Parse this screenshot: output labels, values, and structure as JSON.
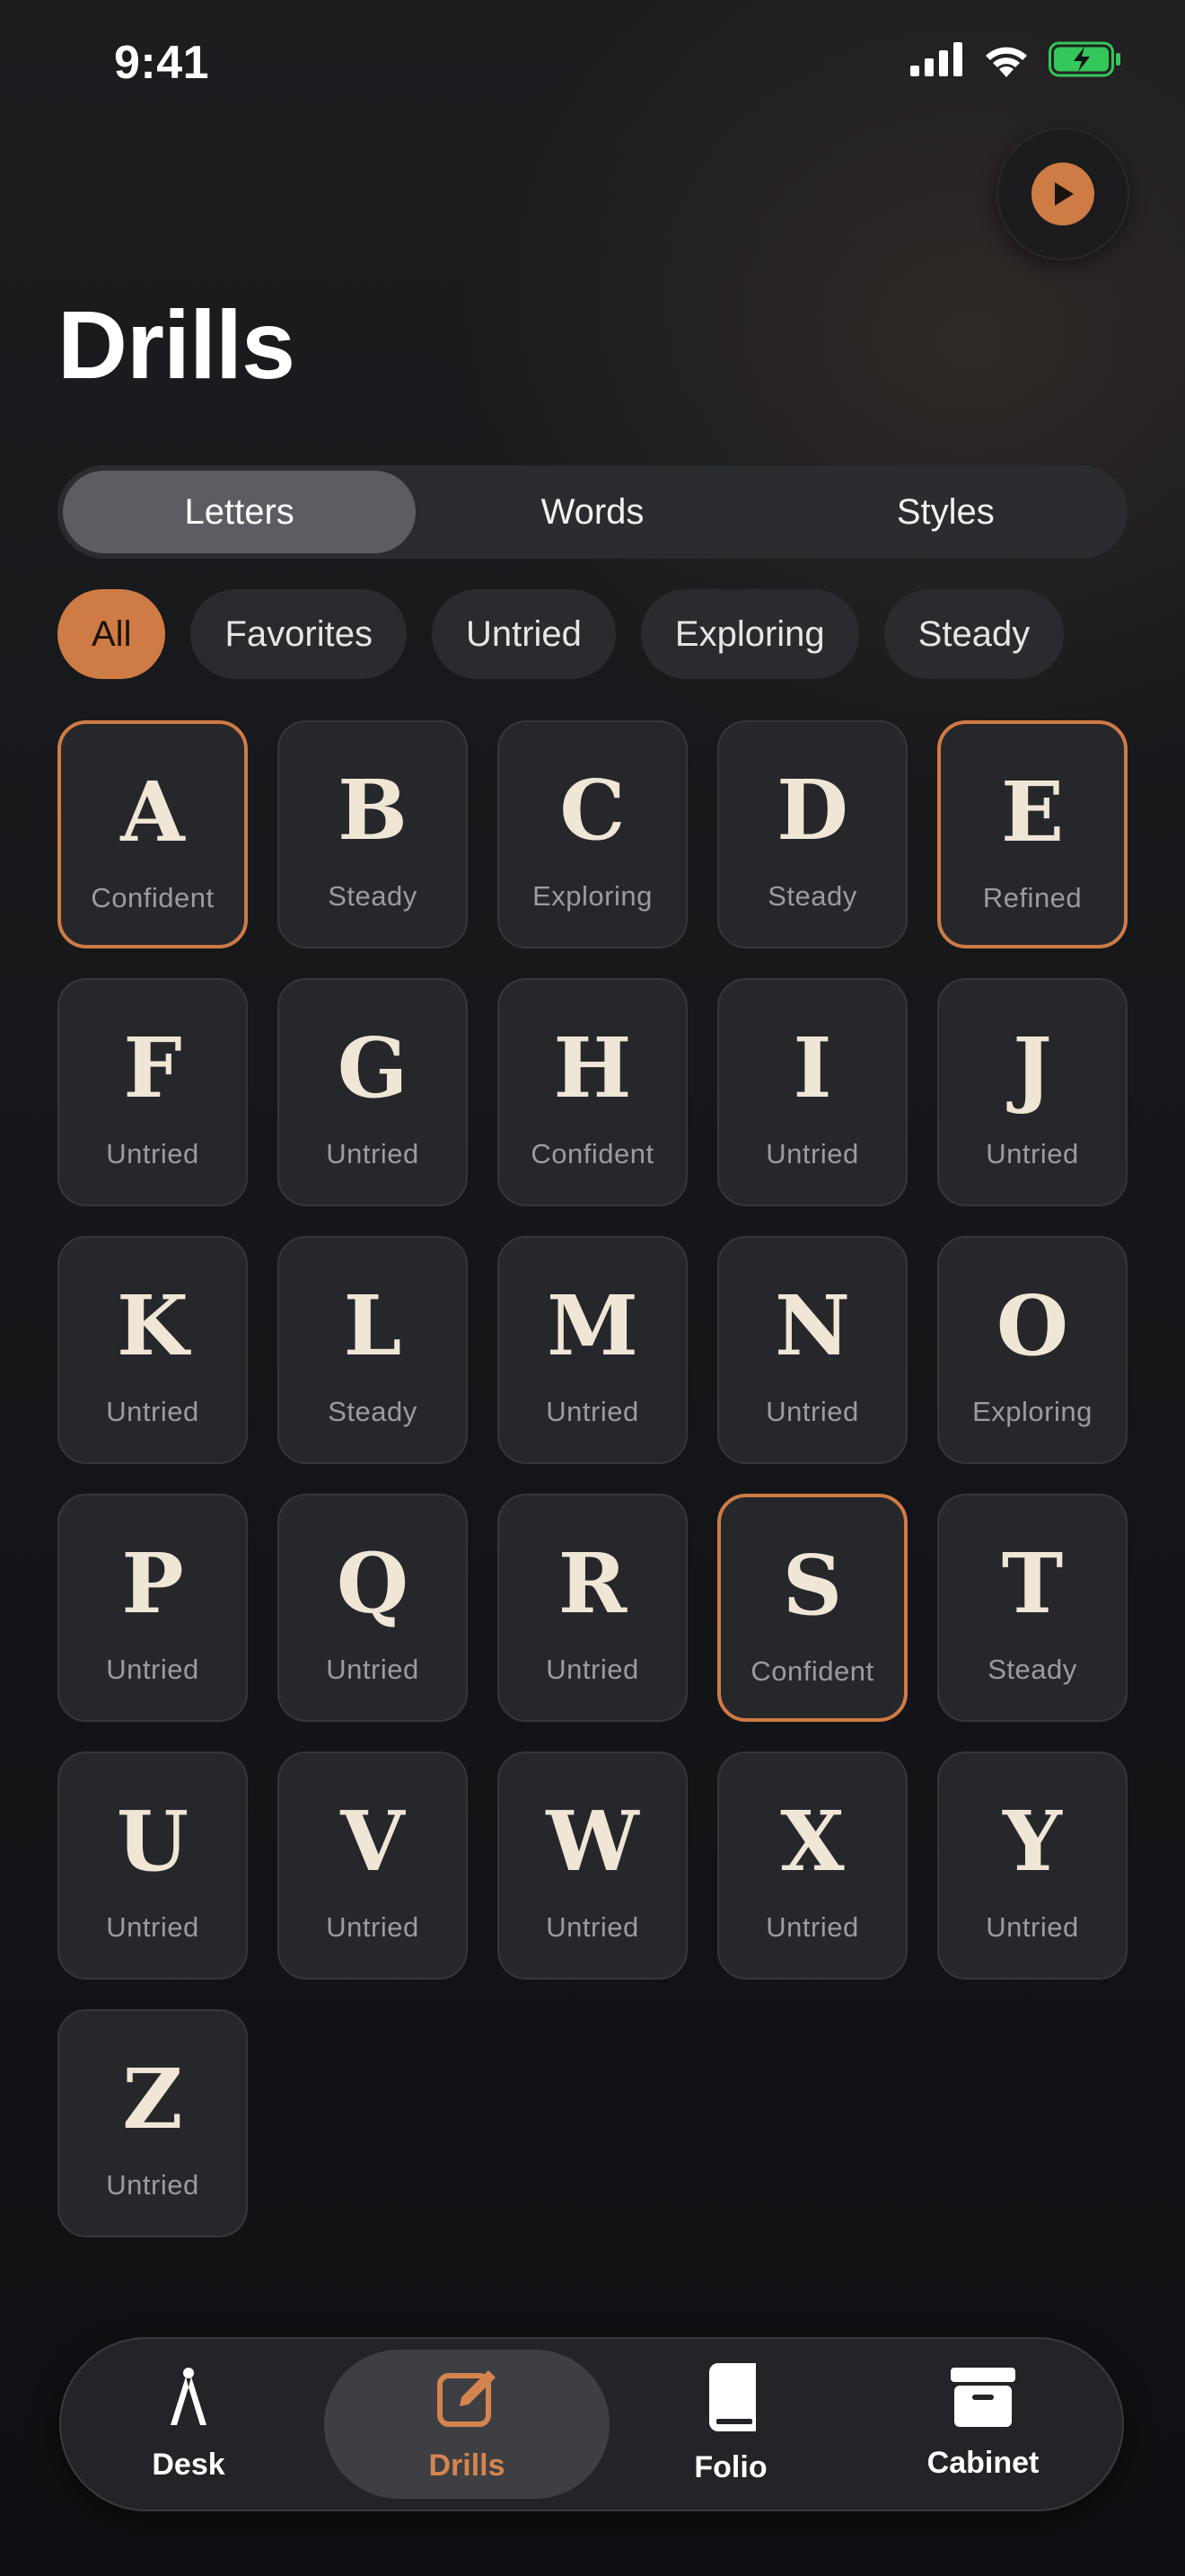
{
  "status_bar": {
    "time": "9:41"
  },
  "header": {
    "title": "Drills",
    "play_icon": "play-icon"
  },
  "segments": [
    {
      "label": "Letters",
      "active": true
    },
    {
      "label": "Words",
      "active": false
    },
    {
      "label": "Styles",
      "active": false
    }
  ],
  "filters": [
    {
      "label": "All",
      "active": true
    },
    {
      "label": "Favorites",
      "active": false
    },
    {
      "label": "Untried",
      "active": false
    },
    {
      "label": "Exploring",
      "active": false
    },
    {
      "label": "Steady",
      "active": false
    }
  ],
  "letters": [
    {
      "letter": "A",
      "status": "Confident",
      "highlight": true
    },
    {
      "letter": "B",
      "status": "Steady",
      "highlight": false
    },
    {
      "letter": "C",
      "status": "Exploring",
      "highlight": false
    },
    {
      "letter": "D",
      "status": "Steady",
      "highlight": false
    },
    {
      "letter": "E",
      "status": "Refined",
      "highlight": true
    },
    {
      "letter": "F",
      "status": "Untried",
      "highlight": false
    },
    {
      "letter": "G",
      "status": "Untried",
      "highlight": false
    },
    {
      "letter": "H",
      "status": "Confident",
      "highlight": false
    },
    {
      "letter": "I",
      "status": "Untried",
      "highlight": false
    },
    {
      "letter": "J",
      "status": "Untried",
      "highlight": false
    },
    {
      "letter": "K",
      "status": "Untried",
      "highlight": false
    },
    {
      "letter": "L",
      "status": "Steady",
      "highlight": false
    },
    {
      "letter": "M",
      "status": "Untried",
      "highlight": false
    },
    {
      "letter": "N",
      "status": "Untried",
      "highlight": false
    },
    {
      "letter": "O",
      "status": "Exploring",
      "highlight": false
    },
    {
      "letter": "P",
      "status": "Untried",
      "highlight": false
    },
    {
      "letter": "Q",
      "status": "Untried",
      "highlight": false
    },
    {
      "letter": "R",
      "status": "Untried",
      "highlight": false
    },
    {
      "letter": "S",
      "status": "Confident",
      "highlight": true
    },
    {
      "letter": "T",
      "status": "Steady",
      "highlight": false
    },
    {
      "letter": "U",
      "status": "Untried",
      "highlight": false
    },
    {
      "letter": "V",
      "status": "Untried",
      "highlight": false
    },
    {
      "letter": "W",
      "status": "Untried",
      "highlight": false
    },
    {
      "letter": "X",
      "status": "Untried",
      "highlight": false
    },
    {
      "letter": "Y",
      "status": "Untried",
      "highlight": false
    },
    {
      "letter": "Z",
      "status": "Untried",
      "highlight": false
    }
  ],
  "tabbar": [
    {
      "label": "Desk",
      "icon": "compass-icon",
      "active": false
    },
    {
      "label": "Drills",
      "icon": "edit-icon",
      "active": true
    },
    {
      "label": "Folio",
      "icon": "book-icon",
      "active": false
    },
    {
      "label": "Cabinet",
      "icon": "archive-box-icon",
      "active": false
    }
  ],
  "colors": {
    "accent": "#cf7b45",
    "tile_bg": "#26272b",
    "tile_text": "#efe6d6",
    "muted_text": "#9b9ca2",
    "battery_green": "#34c759"
  }
}
